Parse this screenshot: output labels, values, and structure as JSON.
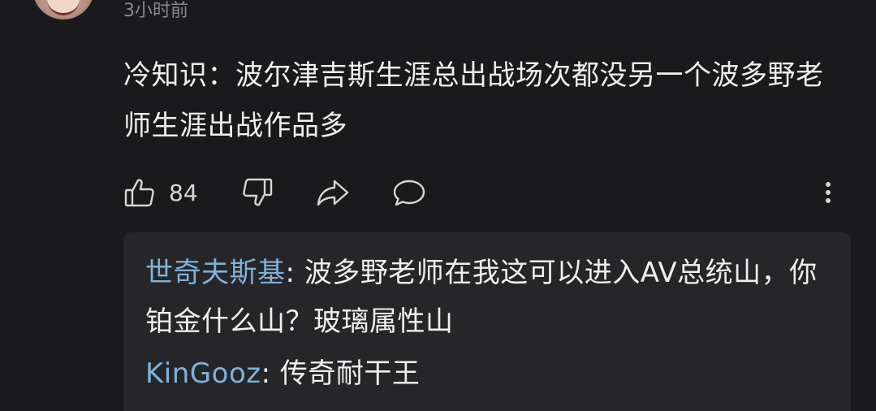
{
  "comment": {
    "timestamp": "3小时前",
    "text": "冷知识：波尔津吉斯生涯总出战场次都没另一个波多野老师生涯出战作品多",
    "like_count": "84"
  },
  "actions": {
    "like_icon": "thumbs-up-icon",
    "dislike_icon": "thumbs-down-icon",
    "share_icon": "share-icon",
    "reply_icon": "reply-bubble-icon",
    "more_icon": "more-vertical-icon"
  },
  "replies": [
    {
      "author": "世奇夫斯基",
      "separator": ": ",
      "text": "波多野老师在我这可以进入AV总统山，你铂金什么山？玻璃属性山"
    },
    {
      "author": "KinGooz",
      "separator": ": ",
      "text": "传奇耐干王"
    }
  ],
  "colors": {
    "background": "#1a1a1c",
    "reply_box": "#262629",
    "author_link": "#7fb2d8",
    "muted_text": "#8a8a8e"
  }
}
